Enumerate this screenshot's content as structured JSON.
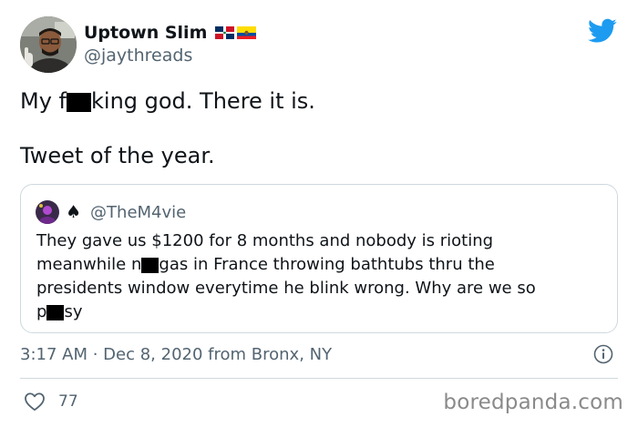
{
  "author": {
    "display_name": "Uptown Slim",
    "handle": "@jaythreads",
    "avatar_icon": "profile-photo",
    "flags": [
      "dominican-republic-flag",
      "ecuador-flag"
    ]
  },
  "tweet": {
    "line1_pre": "My f",
    "line1_post": "king god. There it is.",
    "line2": "Tweet of the year."
  },
  "quoted_tweet": {
    "handle": "@TheM4vie",
    "badge": "♠",
    "lines": {
      "l1": "They gave us $1200 for 8 months and nobody is rioting",
      "l2_pre": "meanwhile n",
      "l2_post": "gas in France throwing bathtubs thru the",
      "l3": "presidents window everytime he blink wrong. Why are we so",
      "l4_pre": "p",
      "l4_post": "sy"
    }
  },
  "meta": {
    "time": "3:17 AM",
    "separator": " · ",
    "date_location": "Dec 8, 2020 from Bronx, NY",
    "info_icon": "info-icon"
  },
  "engagement": {
    "likes": "77",
    "like_icon": "heart-icon"
  },
  "watermark": "boredpanda.com",
  "colors": {
    "twitter_blue": "#1d9bf0",
    "text": "#0f1419",
    "secondary": "#536471",
    "border": "#cfd9de"
  }
}
